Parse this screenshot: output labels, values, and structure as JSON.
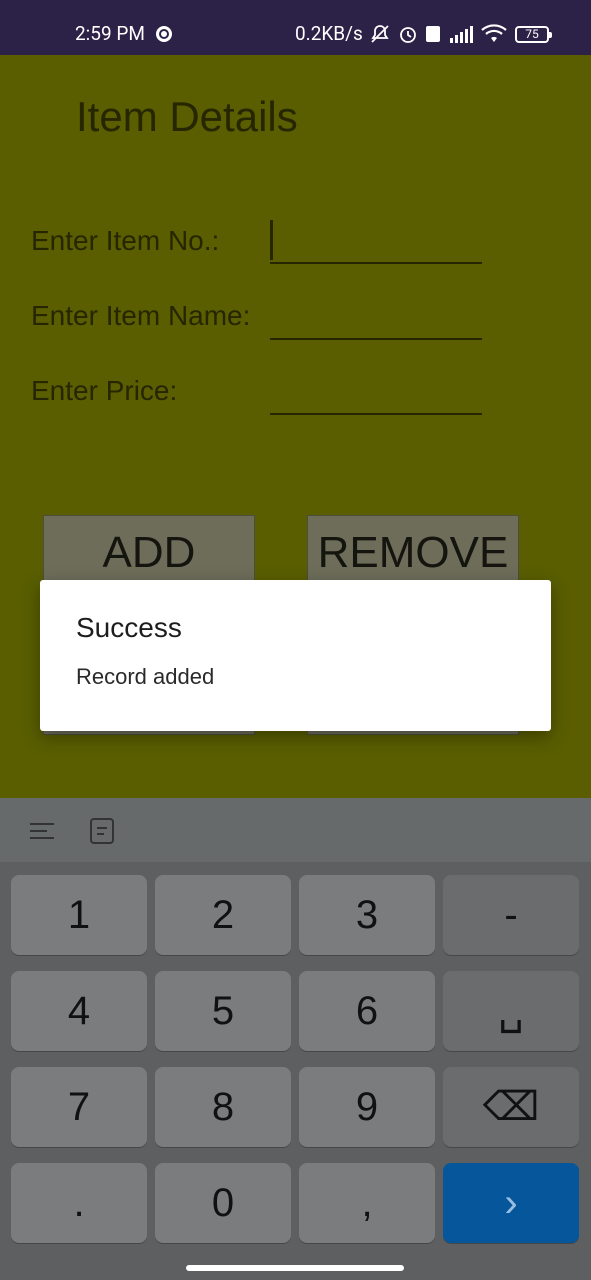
{
  "status_bar": {
    "time": "2:59 PM",
    "net_speed": "0.2KB/s",
    "battery": "75",
    "icons": [
      "chrome-icon",
      "bell-off-icon",
      "alarm-icon",
      "volte-icon",
      "signal-icon",
      "wifi-icon",
      "battery-icon"
    ]
  },
  "app": {
    "title": "Item Details",
    "fields": [
      {
        "label": "Enter Item No.:",
        "value": ""
      },
      {
        "label": "Enter Item Name:",
        "value": ""
      },
      {
        "label": "Enter Price:",
        "value": ""
      }
    ],
    "buttons": {
      "add": "ADD",
      "remove": "REMOVE"
    },
    "colors": {
      "background_dimmed": "#5a5e00"
    }
  },
  "dialog": {
    "title": "Success",
    "message": "Record added"
  },
  "keyboard": {
    "toolbar_icons": [
      "lines-icon",
      "clipboard-icon"
    ],
    "rows": [
      [
        "1",
        "2",
        "3",
        "-"
      ],
      [
        "4",
        "5",
        "6",
        "␣"
      ],
      [
        "7",
        "8",
        "9",
        "⌫"
      ],
      [
        ".",
        "0",
        ",",
        "›"
      ]
    ],
    "colors": {
      "go_key": "#05569b"
    }
  }
}
